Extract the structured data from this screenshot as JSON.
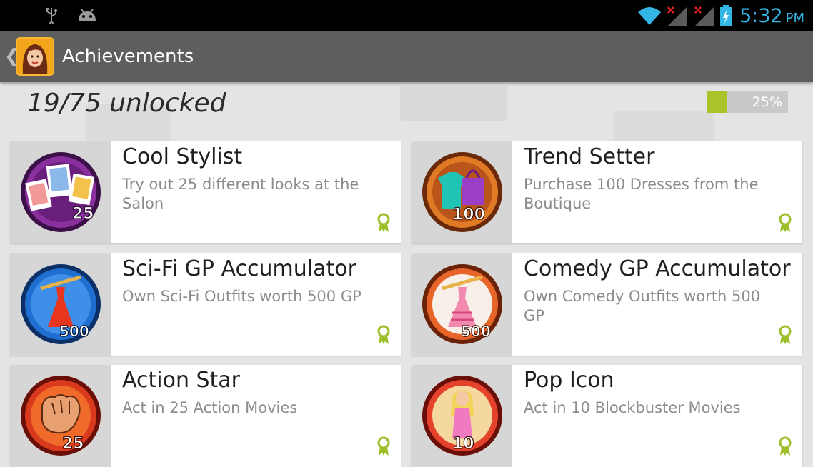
{
  "status_bar": {
    "time": "5:32",
    "ampm": "PM",
    "left_icons": [
      "usb-icon",
      "android-debug-icon"
    ],
    "right_icons": [
      "wifi-icon",
      "signal-no-service-icon",
      "signal-no-service-icon",
      "battery-charging-icon"
    ],
    "accent_color": "#33b5e5"
  },
  "action_bar": {
    "back_icon": "chevron-left-icon",
    "app_icon": "app-avatar-icon",
    "title": "Achievements"
  },
  "summary": {
    "unlocked_text": "19/75 unlocked",
    "progress_percent": 25,
    "progress_label": "25%",
    "progress_color": "#a9c42a"
  },
  "achievements": [
    {
      "title": "Cool Stylist",
      "description": "Try out 25 different looks at the Salon",
      "badge_number": "25",
      "badge_icon": "photos-badge-icon",
      "badge_color": "#7a2c8c"
    },
    {
      "title": "Trend Setter",
      "description": "Purchase 100 Dresses from the Boutique",
      "badge_number": "100",
      "badge_icon": "shopping-bag-badge-icon",
      "badge_color": "#e07a25"
    },
    {
      "title": "Sci-Fi GP Accumulator",
      "description": "Own Sci-Fi Outfits worth 500 GP",
      "badge_number": "500",
      "badge_icon": "dress-hanger-badge-icon",
      "badge_color": "#1e6fd0"
    },
    {
      "title": "Comedy GP Accumulator",
      "description": "Own Comedy Outfits worth 500 GP",
      "badge_number": "500",
      "badge_icon": "dress-hanger-badge-icon",
      "badge_color": "#e8652a"
    },
    {
      "title": "Action Star",
      "description": "Act in 25 Action Movies",
      "badge_number": "25",
      "badge_icon": "fist-badge-icon",
      "badge_color": "#d93a1e"
    },
    {
      "title": "Pop Icon",
      "description": "Act in 10 Blockbuster Movies",
      "badge_number": "10",
      "badge_icon": "star-girl-badge-icon",
      "badge_color": "#e4422a"
    }
  ],
  "ribbon_icon": "award-ribbon-icon",
  "ribbon_color": "#9fbf2a"
}
